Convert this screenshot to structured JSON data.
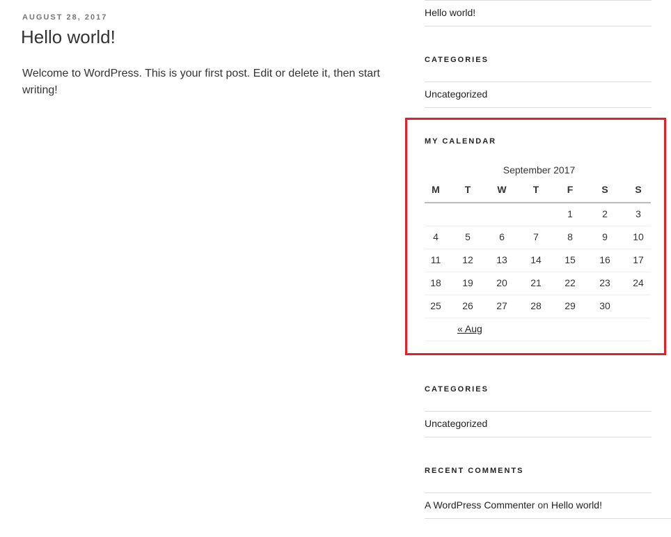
{
  "post": {
    "date": "AUGUST 28, 2017",
    "title": "Hello world!",
    "body": "Welcome to WordPress. This is your first post. Edit or delete it, then start writing!"
  },
  "sidebar": {
    "top_link": "Hello world!",
    "categories_1": {
      "title": "CATEGORIES",
      "item": "Uncategorized"
    },
    "calendar": {
      "title": "MY CALENDAR",
      "caption": "September 2017",
      "weekdays": [
        "M",
        "T",
        "W",
        "T",
        "F",
        "S",
        "S"
      ],
      "weeks": [
        [
          "",
          "",
          "",
          "",
          "1",
          "2",
          "3"
        ],
        [
          "4",
          "5",
          "6",
          "7",
          "8",
          "9",
          "10"
        ],
        [
          "11",
          "12",
          "13",
          "14",
          "15",
          "16",
          "17"
        ],
        [
          "18",
          "19",
          "20",
          "21",
          "22",
          "23",
          "24"
        ],
        [
          "25",
          "26",
          "27",
          "28",
          "29",
          "30",
          ""
        ]
      ],
      "prev_link": "« Aug"
    },
    "categories_2": {
      "title": "CATEGORIES",
      "item": "Uncategorized"
    },
    "recent_comments": {
      "title": "RECENT COMMENTS",
      "author": "A WordPress Commenter",
      "connector": "on",
      "post": "Hello world!"
    }
  },
  "highlight_color": "#e0202a"
}
